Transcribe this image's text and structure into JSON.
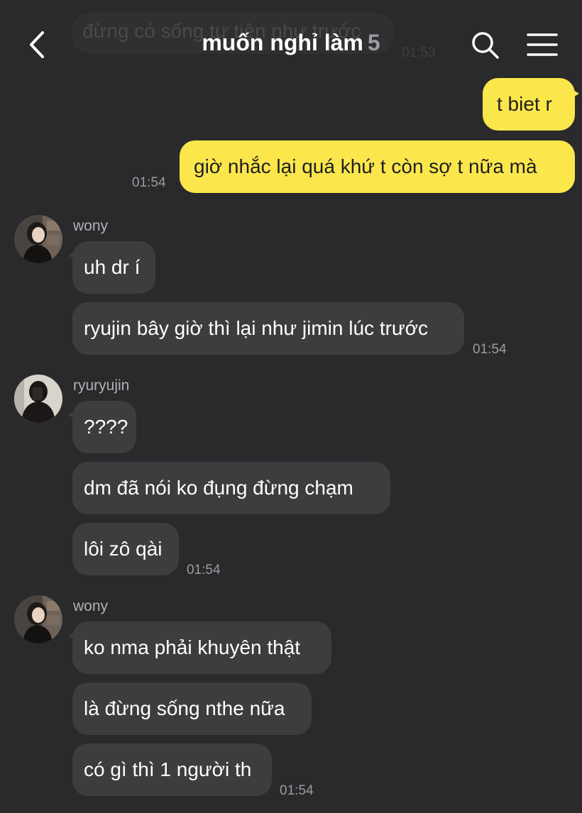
{
  "header": {
    "title": "muốn nghỉ làm",
    "count": "5",
    "ghost_message": "đừng có sống tự tiện như trước",
    "ghost_time": "01:53"
  },
  "messages": {
    "me1": {
      "text": "t biet r"
    },
    "me2": {
      "text": "giờ nhắc lại quá khứ t còn sợ t nữa mà",
      "time": "01:54"
    },
    "group1": {
      "sender": "wony",
      "m1": "uh dr í",
      "m2": "ryujin bây giờ thì lại như jimin lúc trước",
      "time": "01:54"
    },
    "group2": {
      "sender": "ryuryujin",
      "m1": "????",
      "m2": "dm đã nói ko đụng đừng chạm",
      "m3": "lôi zô qài",
      "time": "01:54"
    },
    "group3": {
      "sender": "wony",
      "m1": "ko nma phải khuyên thật",
      "m2": "là đừng sống nthe nữa",
      "m3": "có gì thì 1 người th",
      "time": "01:54"
    }
  },
  "icons": {
    "back": "chevron-left-icon",
    "search": "search-icon",
    "menu": "hamburger-menu-icon"
  },
  "colors": {
    "background": "#2a2a2c",
    "my_bubble": "#fbe74c",
    "other_bubble": "#3d3d40",
    "timestamp": "#9c9ca0"
  }
}
